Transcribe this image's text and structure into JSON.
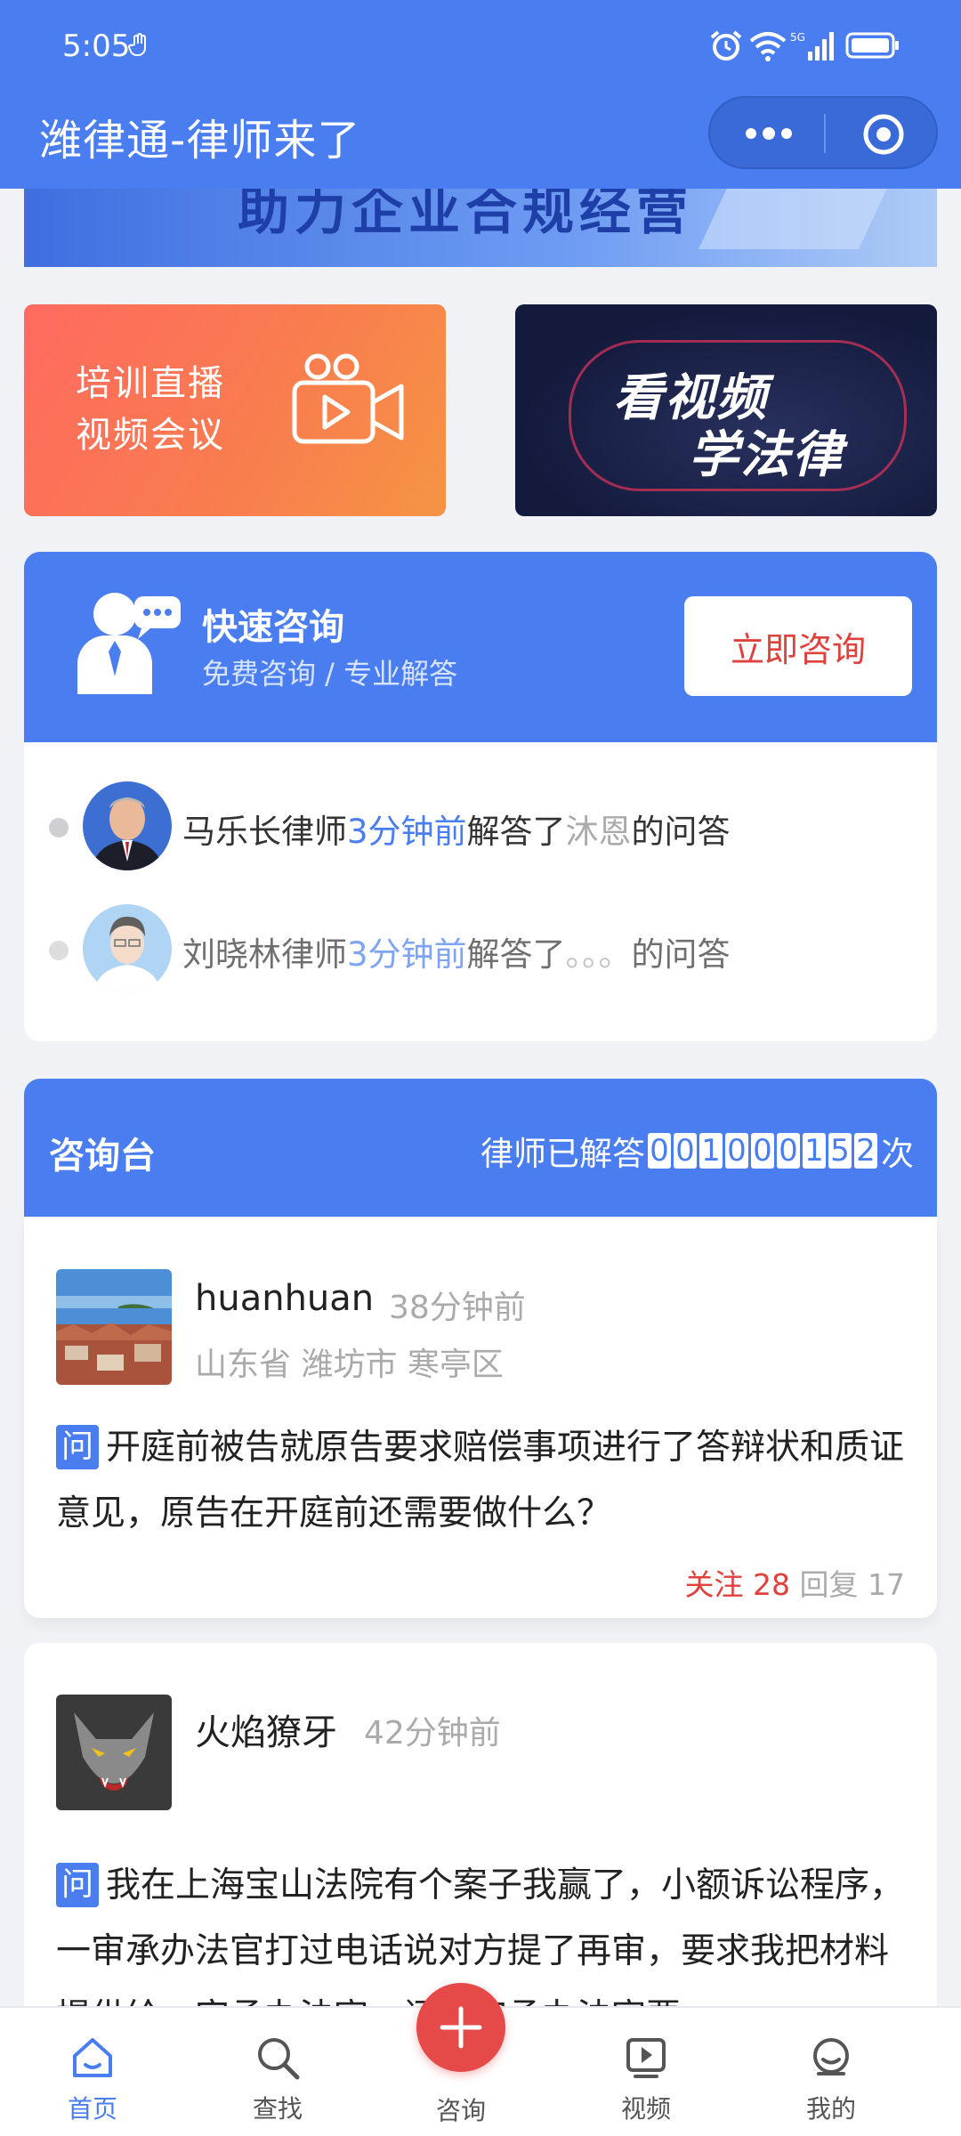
{
  "status_bar": {
    "time": "5:05"
  },
  "header": {
    "title": "潍律通-律师来了"
  },
  "banners": {
    "top_text": "助力企业合规经营",
    "left_text_line1": "培训直播",
    "left_text_line2": "视频会议",
    "right_text_line1": "看视频",
    "right_text_line2": "学法律"
  },
  "quick_consult": {
    "title": "快速咨询",
    "subtitle": "免费咨询 / 专业解答",
    "button_label": "立即咨询",
    "answers": [
      {
        "lawyer": "马乐长律师",
        "time": "3分钟前",
        "action": "解答了",
        "user": "沐恩",
        "suffix": "的问答"
      },
      {
        "lawyer": "刘晓林律师",
        "time": "3分钟前",
        "action": "解答了",
        "user": "。。。",
        "suffix": "的问答"
      }
    ]
  },
  "desk": {
    "title": "咨询台",
    "count_prefix": "律师已解答",
    "digits": [
      "0",
      "0",
      "1",
      "0",
      "0",
      "0",
      "1",
      "5",
      "2"
    ],
    "count_suffix": "次"
  },
  "posts": [
    {
      "username": "huanhuan",
      "time": "38分钟前",
      "location": "山东省 潍坊市 寒亭区",
      "badge": "问",
      "content": "开庭前被告就原告要求赔偿事项进行了答辩状和质证意见，原告在开庭前还需要做什么？",
      "follow_label": "关注",
      "follow_count": "28",
      "reply_label": "回复",
      "reply_count": "17"
    },
    {
      "username": "火焰獠牙",
      "time": "42分钟前",
      "badge": "问",
      "content": "我在上海宝山法院有个案子我赢了，小额诉讼程序，一审承办法官打过电话说对方提了再审，要求我把材料提供给一审承办法官，问一审承办法官要"
    }
  ],
  "bottom_nav": [
    {
      "label": "首页",
      "icon": "home-icon",
      "active": true
    },
    {
      "label": "查找",
      "icon": "search-icon",
      "active": false
    },
    {
      "label": "咨询",
      "icon": "plus-icon",
      "active": false
    },
    {
      "label": "视频",
      "icon": "video-icon",
      "active": false
    },
    {
      "label": "我的",
      "icon": "profile-icon",
      "active": false
    }
  ],
  "colors": {
    "primary": "#4a7ef0",
    "accent_red": "#e0413c",
    "fab": "#e54a48"
  }
}
